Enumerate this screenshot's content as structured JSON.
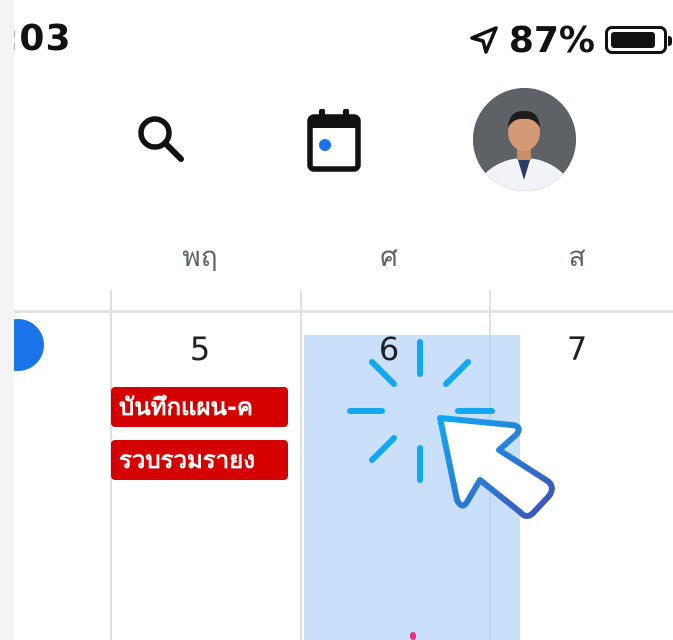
{
  "status_bar": {
    "time": ":03",
    "battery_percent_text": "87%",
    "battery_level": 0.87,
    "location_icon": "location-arrow-icon"
  },
  "toolbar": {
    "search_icon": "search-icon",
    "today_icon": "calendar-today-icon",
    "avatar_icon": "profile-avatar"
  },
  "calendar": {
    "day_headers": [
      "​",
      "พฤ",
      "ศ",
      "ส"
    ],
    "dates": [
      "5",
      "6",
      "7"
    ],
    "events": [
      {
        "label": "บันทึกแผน-ค",
        "color": "#d50000"
      },
      {
        "label": "รวบรวมรายง",
        "color": "#d50000"
      }
    ],
    "selected_day": "6",
    "selection_color": "#a7c9f5",
    "today_color": "#1a73e8"
  },
  "overlay": {
    "cursor_icon": "click-cursor-icon",
    "accent_colors": [
      "#12a7f2",
      "#3f51b5"
    ]
  }
}
